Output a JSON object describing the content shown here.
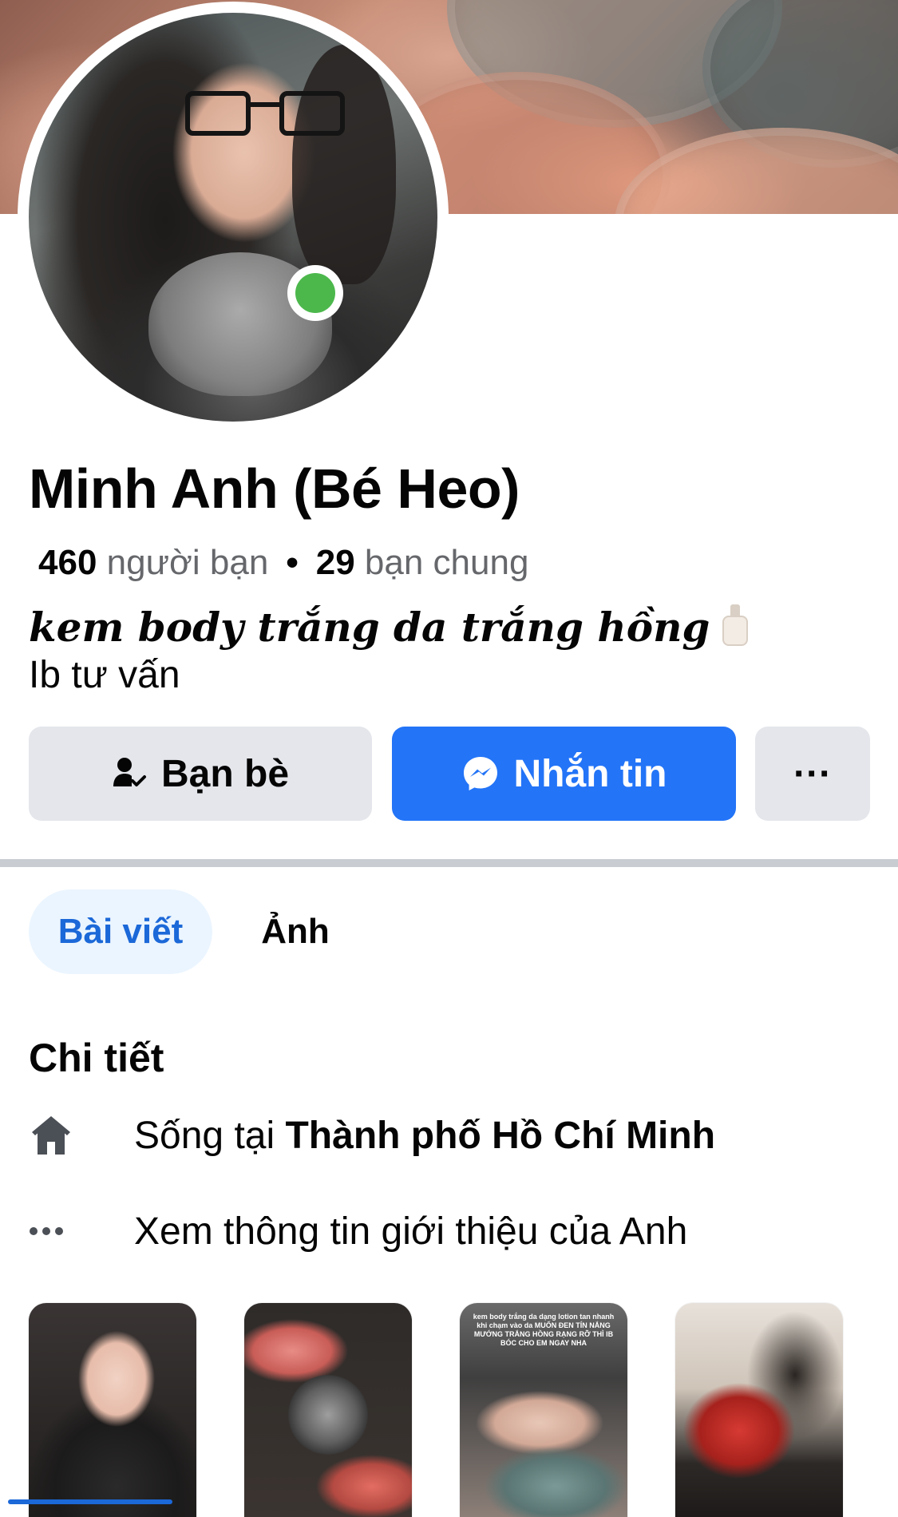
{
  "profile": {
    "name": "Minh Anh (Bé Heo)",
    "friend_count": "460",
    "friend_label": "người bạn",
    "separator": "•",
    "mutual_count": "29",
    "mutual_label": "bạn chung",
    "bio_line_1": "kem body trắng da trắng hồng",
    "bio_line_2": "Ib tư vấn",
    "online": true
  },
  "actions": {
    "friends_label": "Bạn bè",
    "message_label": "Nhắn tin",
    "more_label": "···"
  },
  "tabs": [
    {
      "label": "Bài viết",
      "active": true
    },
    {
      "label": "Ảnh",
      "active": false
    }
  ],
  "details": {
    "title": "Chi tiết",
    "lives_prefix": "Sống tại",
    "lives_city": "Thành phố Hồ Chí Minh",
    "about_link": "Xem thông tin giới thiệu của Anh"
  },
  "photos": {
    "photo_3_caption": "kem body trắng da dạng lotion tan nhanh khi chạm vào da MUỐN ĐEN TÍN NẮNG MƯỚNG TRẮNG HỒNG RẠNG RỠ THÌ IB BÓC CHO EM NGAY NHA"
  },
  "colors": {
    "accent": "#2374f7",
    "tab_active_bg": "#ebf5ff",
    "tab_active_text": "#1b68d8",
    "button_grey": "#e4e6eb",
    "online_green": "#4cb84c",
    "divider": "#c9ccd1"
  },
  "icons": {
    "friends_button": "person-check-icon",
    "message_button": "messenger-icon",
    "more_button": "more-horizontal-icon",
    "lives": "home-icon",
    "about": "more-horizontal-icon",
    "bio_emoji": "lotion-bottle-icon"
  }
}
